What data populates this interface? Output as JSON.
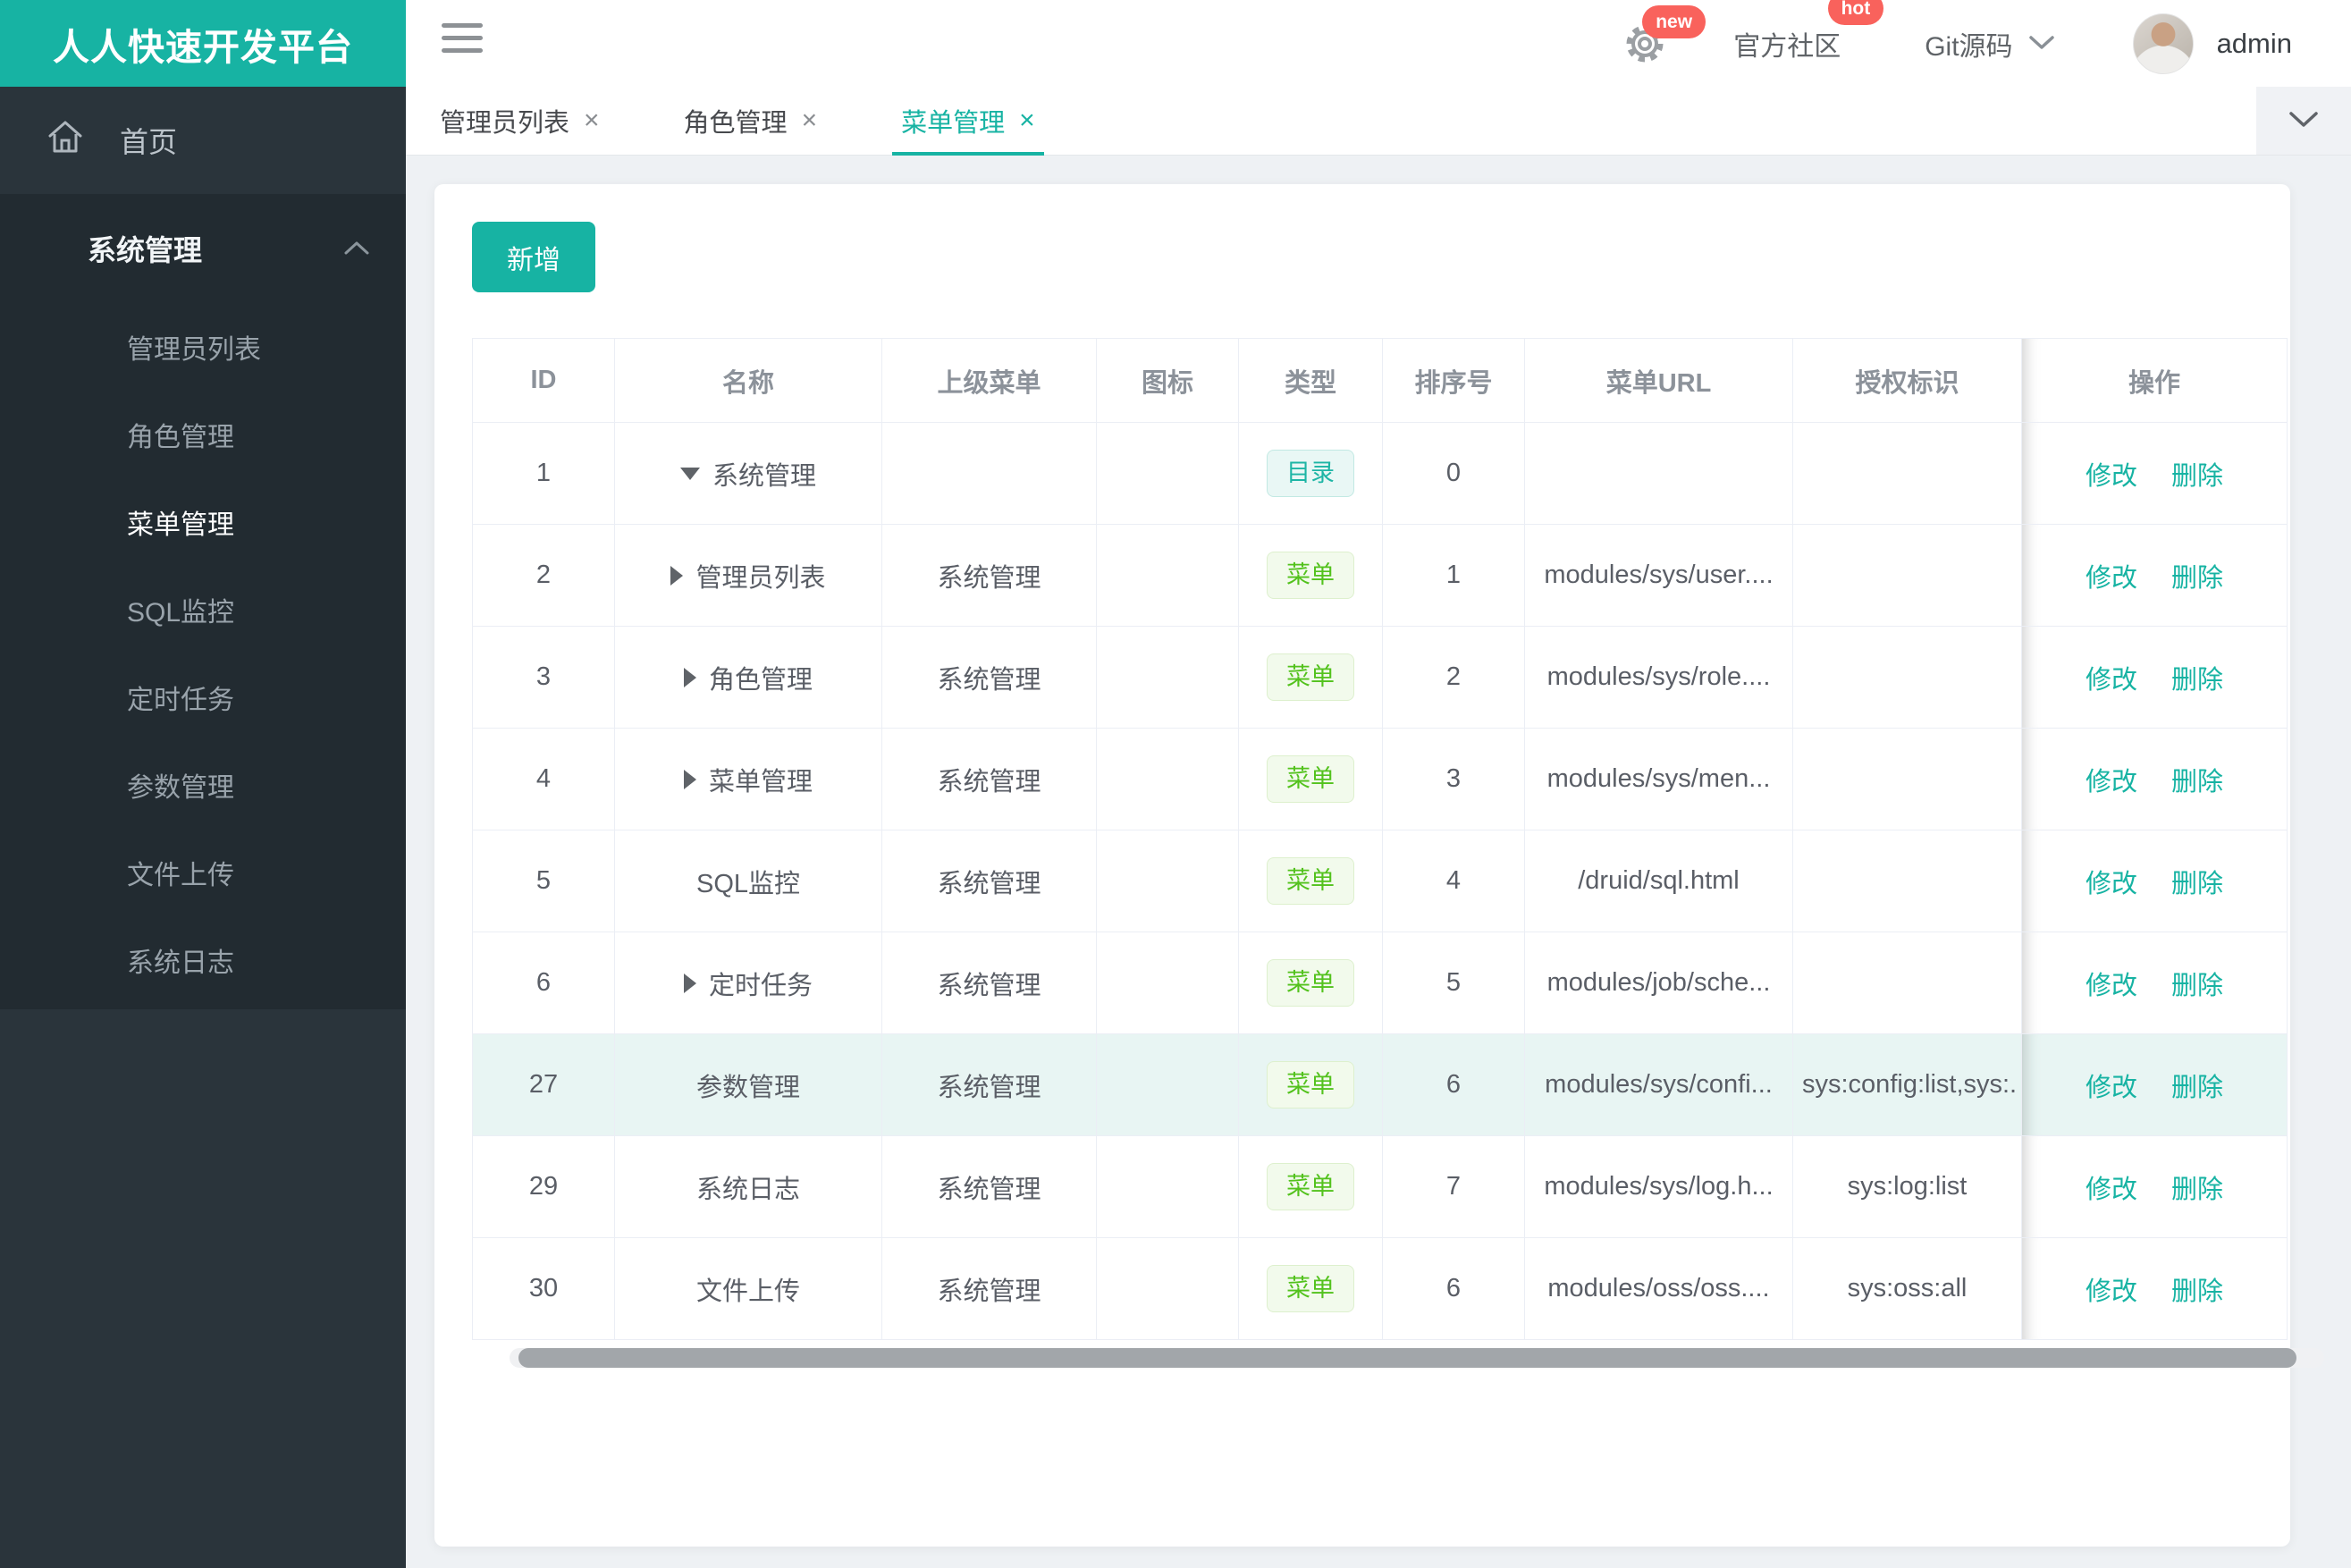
{
  "brand": {
    "title": "人人快速开发平台",
    "accent_color": "#17b3a3"
  },
  "header": {
    "new_badge": "new",
    "community_label": "官方社区",
    "hot_badge": "hot",
    "git_label": "Git源码",
    "username": "admin"
  },
  "sidebar": {
    "home_label": "首页",
    "group_label": "系统管理",
    "items": [
      "管理员列表",
      "角色管理",
      "菜单管理",
      "SQL监控",
      "定时任务",
      "参数管理",
      "文件上传",
      "系统日志"
    ],
    "active_item": "菜单管理"
  },
  "tabs": [
    {
      "label": "管理员列表"
    },
    {
      "label": "角色管理"
    },
    {
      "label": "菜单管理",
      "active": true
    }
  ],
  "toolbar": {
    "add_label": "新增"
  },
  "table": {
    "columns": [
      "ID",
      "名称",
      "上级菜单",
      "图标",
      "类型",
      "排序号",
      "菜单URL",
      "授权标识",
      "操作"
    ],
    "actions": {
      "edit": "修改",
      "delete": "删除"
    },
    "type_colors": {
      "dir": "#1db5a5",
      "menu": "#53c21d"
    },
    "highlight_color": "#e8f5f3",
    "rows": [
      {
        "id": "1",
        "name": "系统管理",
        "parent": "",
        "icon": "",
        "type": "目录",
        "order": "0",
        "url": "",
        "perms": ""
      },
      {
        "id": "2",
        "name": "管理员列表",
        "parent": "系统管理",
        "icon": "",
        "type": "菜单",
        "order": "1",
        "url": "modules/sys/user....",
        "perms": ""
      },
      {
        "id": "3",
        "name": "角色管理",
        "parent": "系统管理",
        "icon": "",
        "type": "菜单",
        "order": "2",
        "url": "modules/sys/role....",
        "perms": ""
      },
      {
        "id": "4",
        "name": "菜单管理",
        "parent": "系统管理",
        "icon": "",
        "type": "菜单",
        "order": "3",
        "url": "modules/sys/men...",
        "perms": ""
      },
      {
        "id": "5",
        "name": "SQL监控",
        "parent": "系统管理",
        "icon": "",
        "type": "菜单",
        "order": "4",
        "url": "/druid/sql.html",
        "perms": ""
      },
      {
        "id": "6",
        "name": "定时任务",
        "parent": "系统管理",
        "icon": "",
        "type": "菜单",
        "order": "5",
        "url": "modules/job/sche...",
        "perms": ""
      },
      {
        "id": "27",
        "name": "参数管理",
        "parent": "系统管理",
        "icon": "",
        "type": "菜单",
        "order": "6",
        "url": "modules/sys/confi...",
        "perms": "sys:config:list,sys:."
      },
      {
        "id": "29",
        "name": "系统日志",
        "parent": "系统管理",
        "icon": "",
        "type": "菜单",
        "order": "7",
        "url": "modules/sys/log.h...",
        "perms": "sys:log:list"
      },
      {
        "id": "30",
        "name": "文件上传",
        "parent": "系统管理",
        "icon": "",
        "type": "菜单",
        "order": "6",
        "url": "modules/oss/oss....",
        "perms": "sys:oss:all"
      }
    ]
  }
}
